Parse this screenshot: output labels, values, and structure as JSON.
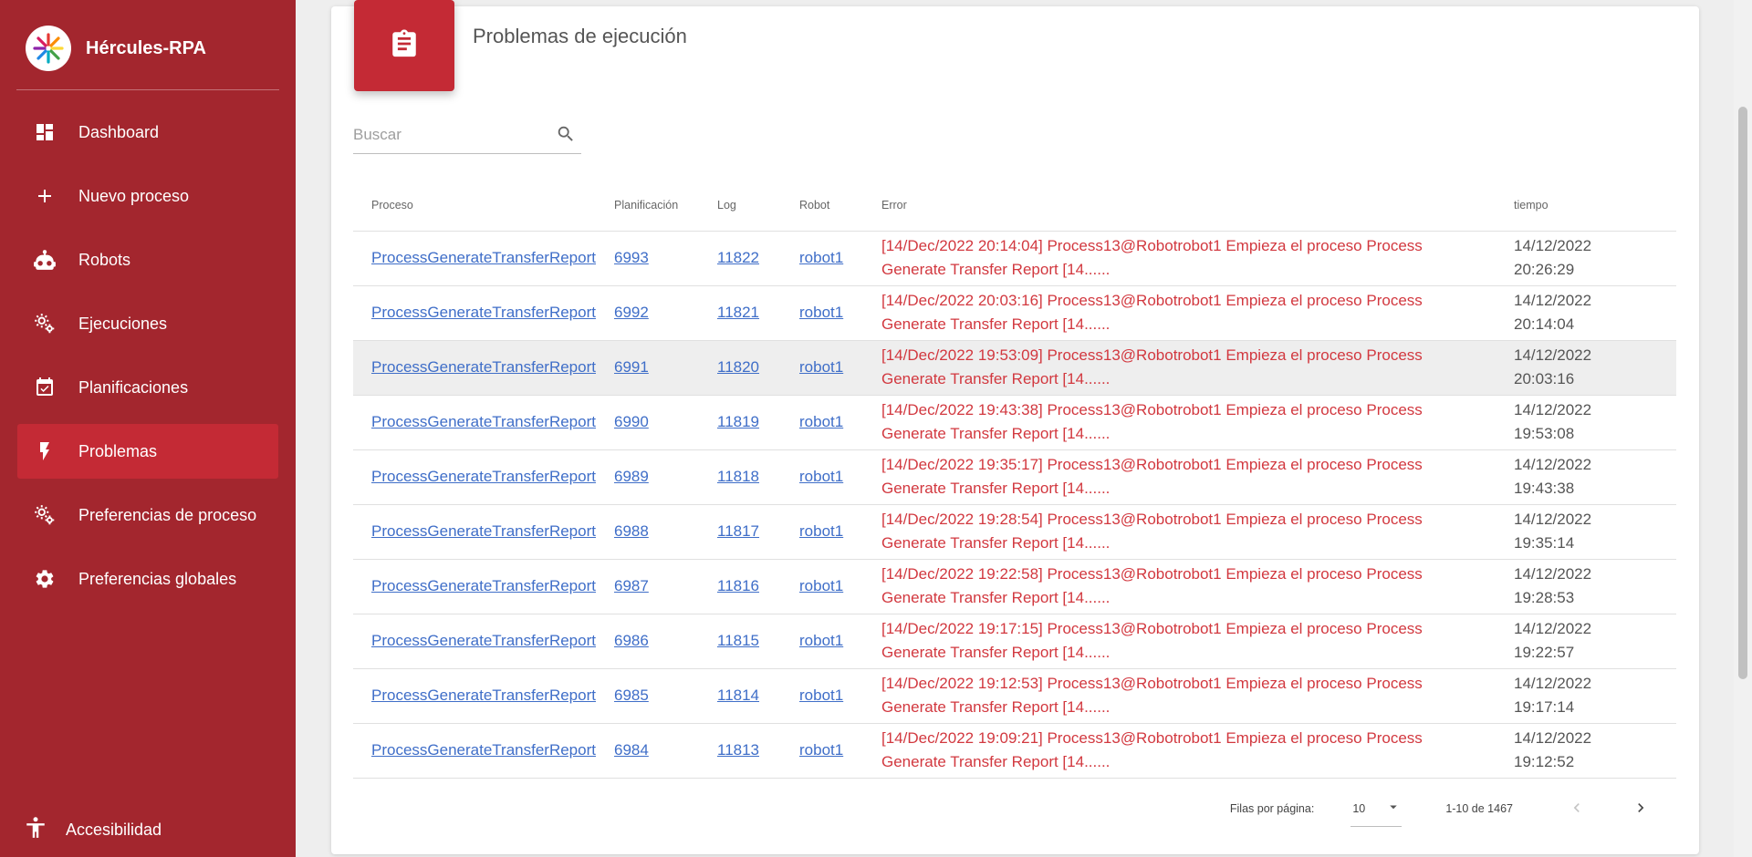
{
  "app": {
    "name": "Hércules-RPA"
  },
  "sidebar": {
    "items": [
      {
        "label": "Dashboard",
        "icon": "dashboard-icon",
        "active": false
      },
      {
        "label": "Nuevo proceso",
        "icon": "plus-icon",
        "active": false
      },
      {
        "label": "Robots",
        "icon": "robot-icon",
        "active": false
      },
      {
        "label": "Ejecuciones",
        "icon": "gears-icon",
        "active": false
      },
      {
        "label": "Planificaciones",
        "icon": "calendar-check-icon",
        "active": false
      },
      {
        "label": "Problemas",
        "icon": "lightning-icon",
        "active": true
      },
      {
        "label": "Preferencias de proceso",
        "icon": "gears-icon",
        "active": false
      },
      {
        "label": "Preferencias globales",
        "icon": "gear-icon",
        "active": false
      }
    ],
    "accessibility_label": "Accesibilidad"
  },
  "page": {
    "title": "Problemas de ejecución",
    "search_placeholder": "Buscar"
  },
  "table": {
    "headers": {
      "proceso": "Proceso",
      "planificacion": "Planificación",
      "log": "Log",
      "robot": "Robot",
      "error": "Error",
      "tiempo": "tiempo"
    },
    "rows": [
      {
        "proceso": "ProcessGenerateTransferReport",
        "planificacion": "6993",
        "log": "11822",
        "robot": "robot1",
        "error_line1": "[14/Dec/2022 20:14:04] Process13@Robotrobot1 Empieza el proceso Process",
        "error_line2": "Generate Transfer Report [14......",
        "date": "14/12/2022",
        "time": "20:26:29"
      },
      {
        "proceso": "ProcessGenerateTransferReport",
        "planificacion": "6992",
        "log": "11821",
        "robot": "robot1",
        "error_line1": "[14/Dec/2022 20:03:16] Process13@Robotrobot1 Empieza el proceso Process",
        "error_line2": "Generate Transfer Report [14......",
        "date": "14/12/2022",
        "time": "20:14:04"
      },
      {
        "proceso": "ProcessGenerateTransferReport",
        "planificacion": "6991",
        "log": "11820",
        "robot": "robot1",
        "error_line1": "[14/Dec/2022 19:53:09] Process13@Robotrobot1 Empieza el proceso Process",
        "error_line2": "Generate Transfer Report [14......",
        "date": "14/12/2022",
        "time": "20:03:16"
      },
      {
        "proceso": "ProcessGenerateTransferReport",
        "planificacion": "6990",
        "log": "11819",
        "robot": "robot1",
        "error_line1": "[14/Dec/2022 19:43:38] Process13@Robotrobot1 Empieza el proceso Process",
        "error_line2": "Generate Transfer Report [14......",
        "date": "14/12/2022",
        "time": "19:53:08"
      },
      {
        "proceso": "ProcessGenerateTransferReport",
        "planificacion": "6989",
        "log": "11818",
        "robot": "robot1",
        "error_line1": "[14/Dec/2022 19:35:17] Process13@Robotrobot1 Empieza el proceso Process",
        "error_line2": "Generate Transfer Report [14......",
        "date": "14/12/2022",
        "time": "19:43:38"
      },
      {
        "proceso": "ProcessGenerateTransferReport",
        "planificacion": "6988",
        "log": "11817",
        "robot": "robot1",
        "error_line1": "[14/Dec/2022 19:28:54] Process13@Robotrobot1 Empieza el proceso Process",
        "error_line2": "Generate Transfer Report [14......",
        "date": "14/12/2022",
        "time": "19:35:14"
      },
      {
        "proceso": "ProcessGenerateTransferReport",
        "planificacion": "6987",
        "log": "11816",
        "robot": "robot1",
        "error_line1": "[14/Dec/2022 19:22:58] Process13@Robotrobot1 Empieza el proceso Process",
        "error_line2": "Generate Transfer Report [14......",
        "date": "14/12/2022",
        "time": "19:28:53"
      },
      {
        "proceso": "ProcessGenerateTransferReport",
        "planificacion": "6986",
        "log": "11815",
        "robot": "robot1",
        "error_line1": "[14/Dec/2022 19:17:15] Process13@Robotrobot1 Empieza el proceso Process",
        "error_line2": "Generate Transfer Report [14......",
        "date": "14/12/2022",
        "time": "19:22:57"
      },
      {
        "proceso": "ProcessGenerateTransferReport",
        "planificacion": "6985",
        "log": "11814",
        "robot": "robot1",
        "error_line1": "[14/Dec/2022 19:12:53] Process13@Robotrobot1 Empieza el proceso Process",
        "error_line2": "Generate Transfer Report [14......",
        "date": "14/12/2022",
        "time": "19:17:14"
      },
      {
        "proceso": "ProcessGenerateTransferReport",
        "planificacion": "6984",
        "log": "11813",
        "robot": "robot1",
        "error_line1": "[14/Dec/2022 19:09:21] Process13@Robotrobot1 Empieza el proceso Process",
        "error_line2": "Generate Transfer Report [14......",
        "date": "14/12/2022",
        "time": "19:12:52"
      }
    ]
  },
  "pagination": {
    "rows_per_page_label": "Filas por página:",
    "rows_per_page": "10",
    "range": "1-10 de 1467"
  },
  "colors": {
    "sidebar": "#a3262e",
    "active_item": "#c42a35",
    "link": "#3f6ec8",
    "error_text": "#d2383f"
  }
}
